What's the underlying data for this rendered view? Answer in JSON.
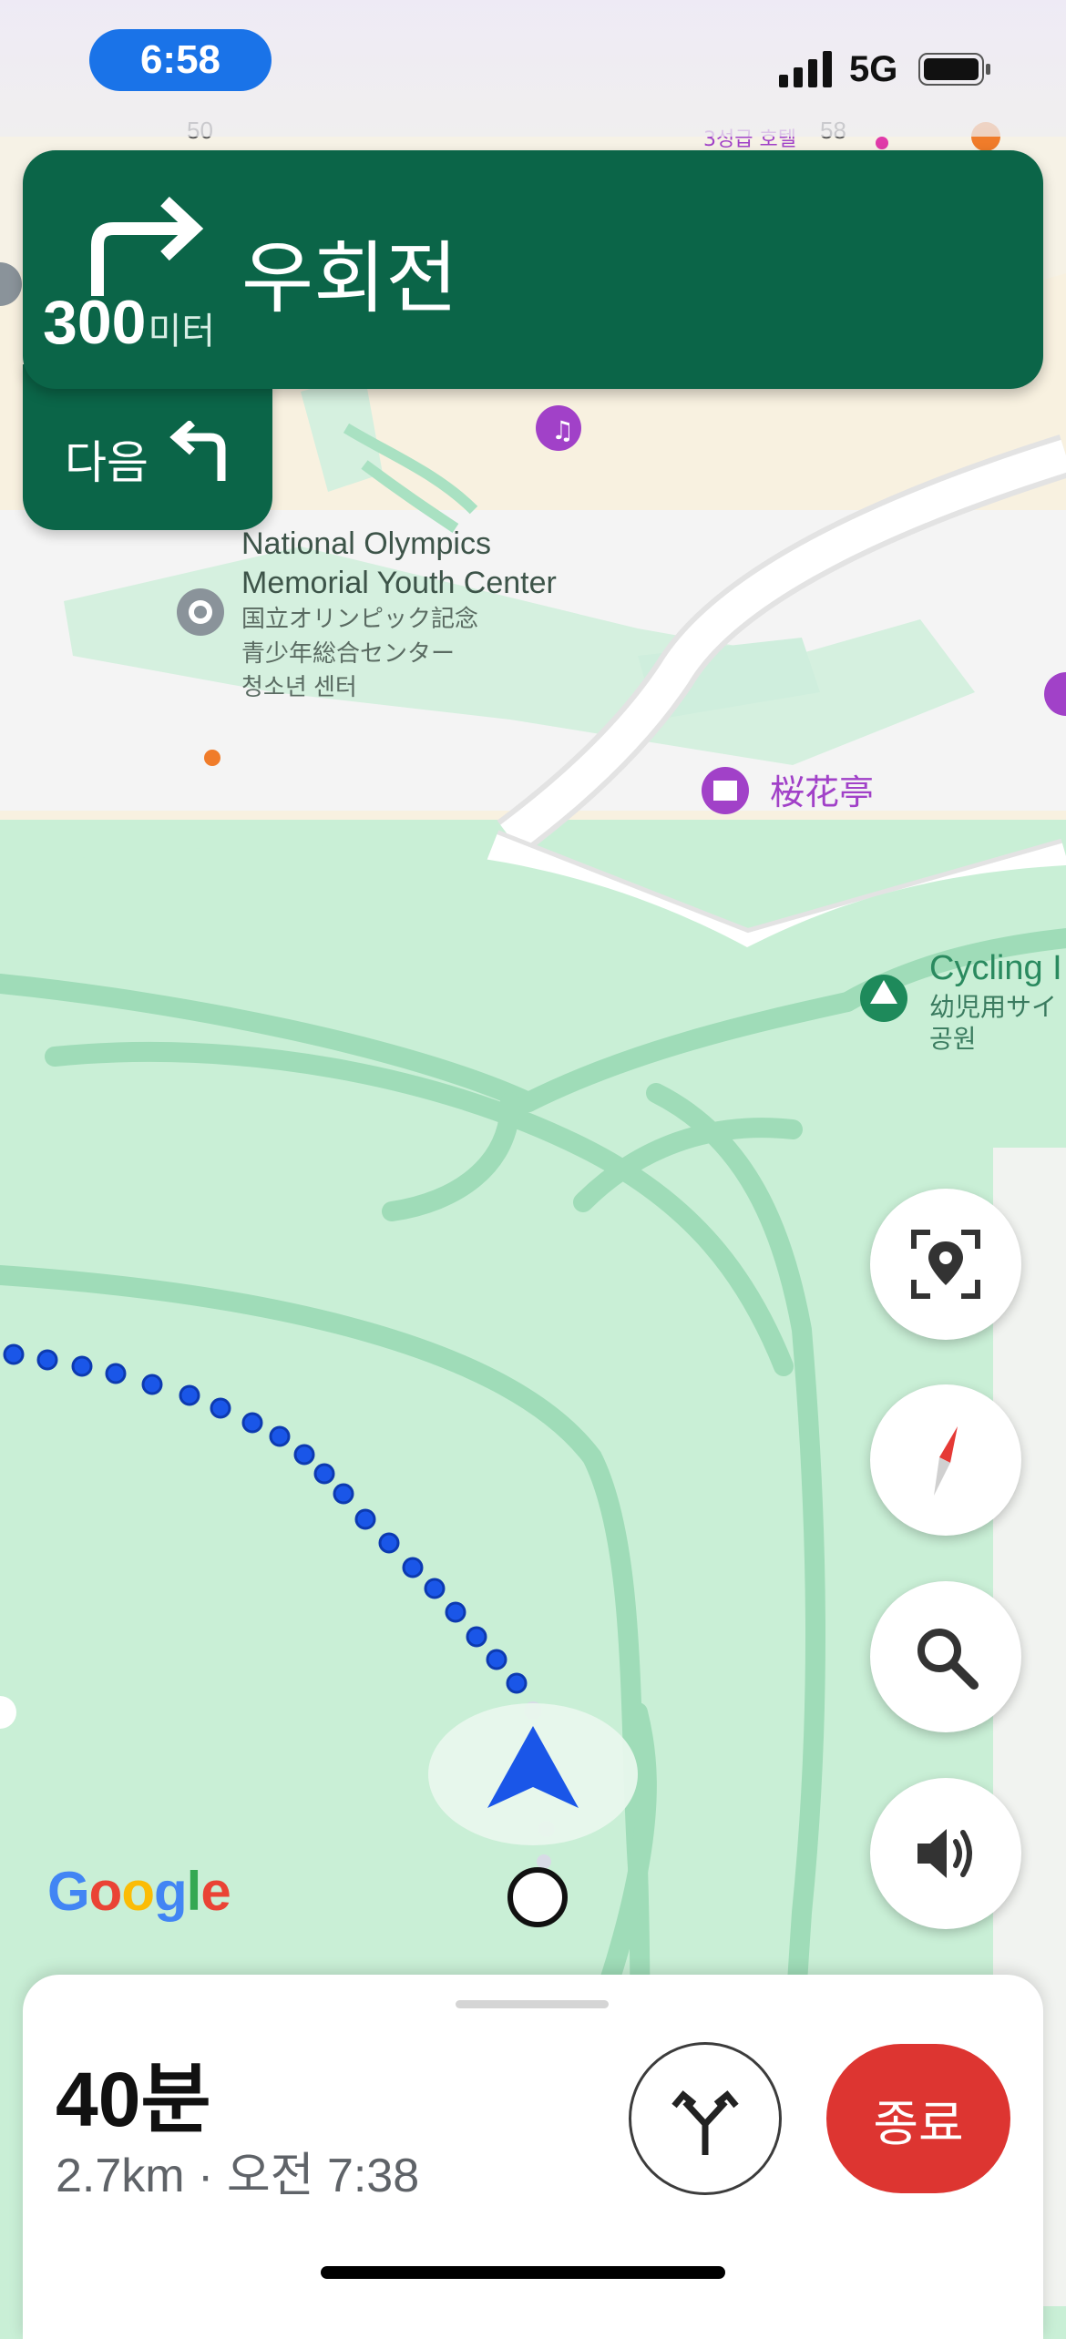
{
  "status_bar": {
    "time": "6:58",
    "network": "5G"
  },
  "navigation": {
    "maneuver_icon": "turn-right-icon",
    "distance_value": "300",
    "distance_unit": "미터",
    "instruction": "우회전",
    "next_label": "다음",
    "next_icon": "turn-left-icon"
  },
  "map": {
    "labels": {
      "olympic_line1": "National Olympics",
      "olympic_line2": "Memorial Youth Center",
      "olympic_jp1": "国立オリンピック記念",
      "olympic_jp2": "青少年総合センター",
      "olympic_ko": "청소년 센터",
      "sakura": "桜花亭",
      "cycling": "Cycling I",
      "cycling_jp": "幼児用サイ",
      "cycling_ko": "공원",
      "top_hotel": "3성급 호텔",
      "top_num_left": "50",
      "top_num_right": "58"
    },
    "colors": {
      "park": "#c9efd6",
      "road": "#9fdcb8",
      "route": "#1a56e8",
      "urban": "#f8f1e0"
    }
  },
  "controls": {
    "recenter": "recenter-location-icon",
    "compass": "compass-icon",
    "search": "search-icon",
    "sound": "speaker-icon"
  },
  "brand": {
    "logo_text": "Google"
  },
  "eta": {
    "duration": "40분",
    "details": "2.7km · 오전 7:38",
    "alt_routes_icon": "alternate-routes-icon",
    "end_label": "종료"
  }
}
